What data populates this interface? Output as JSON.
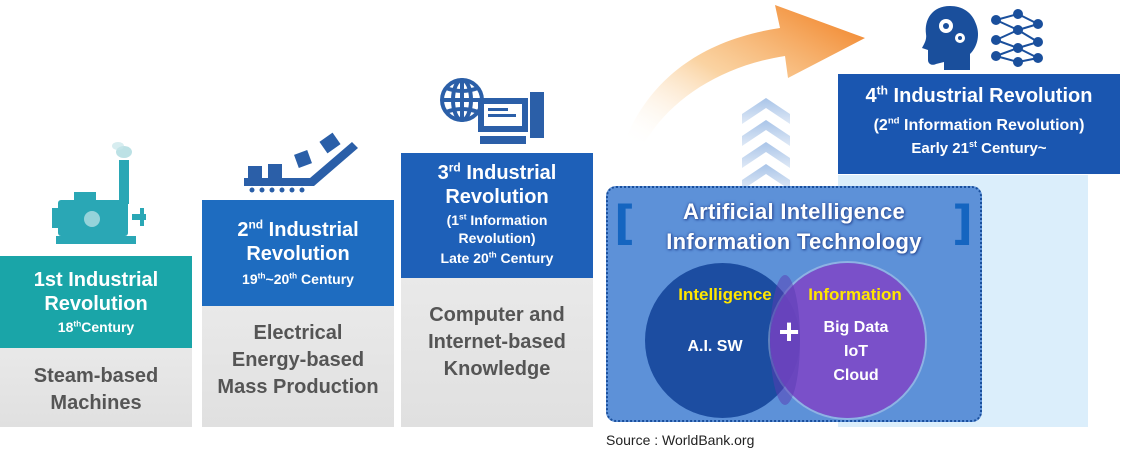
{
  "stage1": {
    "title": "1st Industrial Revolution",
    "century": "18thCentury",
    "description": "Steam-based Machines",
    "icon": "steam-engine-icon",
    "color": "#1aa5a8"
  },
  "stage2": {
    "title": "2nd Industrial Revolution",
    "century": "19th~20th Century",
    "description": "Electrical Energy-based Mass Production",
    "icon": "conveyor-belt-icon",
    "color": "#1e6cc0"
  },
  "stage3": {
    "title": "3rd Industrial Revolution",
    "subtitle": "(1st Information Revolution)",
    "century": "Late 20th Century",
    "description": "Computer and Internet-based Knowledge",
    "icon": "computer-network-icon",
    "color": "#1e60b8"
  },
  "stage4": {
    "title": "4th Industrial Revolution",
    "subtitle": "(2nd Information Revolution)",
    "century": "Early 21st Century~",
    "icons": [
      "brain-gears-icon",
      "neural-network-icon"
    ],
    "color": "#1a56b0"
  },
  "venn": {
    "title_line1": "Artificial Intelligence",
    "title_line2": "Information Technology",
    "left_label": "Intelligence",
    "left_text": "A.I. SW",
    "right_label": "Information",
    "right_items": [
      "Big Data",
      "IoT",
      "Cloud"
    ],
    "plus": "+",
    "label_color": "#ffe600"
  },
  "source": "Source : WorldBank.org"
}
